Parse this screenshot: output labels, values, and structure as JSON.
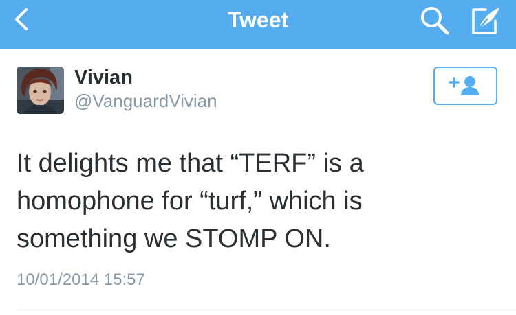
{
  "navbar": {
    "title": "Tweet",
    "back_icon": "chevron-left-icon",
    "search_icon": "search-icon",
    "compose_icon": "compose-icon",
    "background": "#55acee"
  },
  "tweet": {
    "author": {
      "name": "Vivian",
      "handle": "@VanguardVivian",
      "avatar": "profile-photo"
    },
    "follow_icon": "add-user-icon",
    "text_lines": [
      "It delights me that “TERF” is a",
      "homophone for “turf,” which is",
      "something we STOMP ON."
    ],
    "timestamp": "10/01/2014 15:57"
  },
  "colors": {
    "accent": "#55acee",
    "text": "#292f33",
    "muted": "#8899a6",
    "divider": "#e1e8ed"
  }
}
